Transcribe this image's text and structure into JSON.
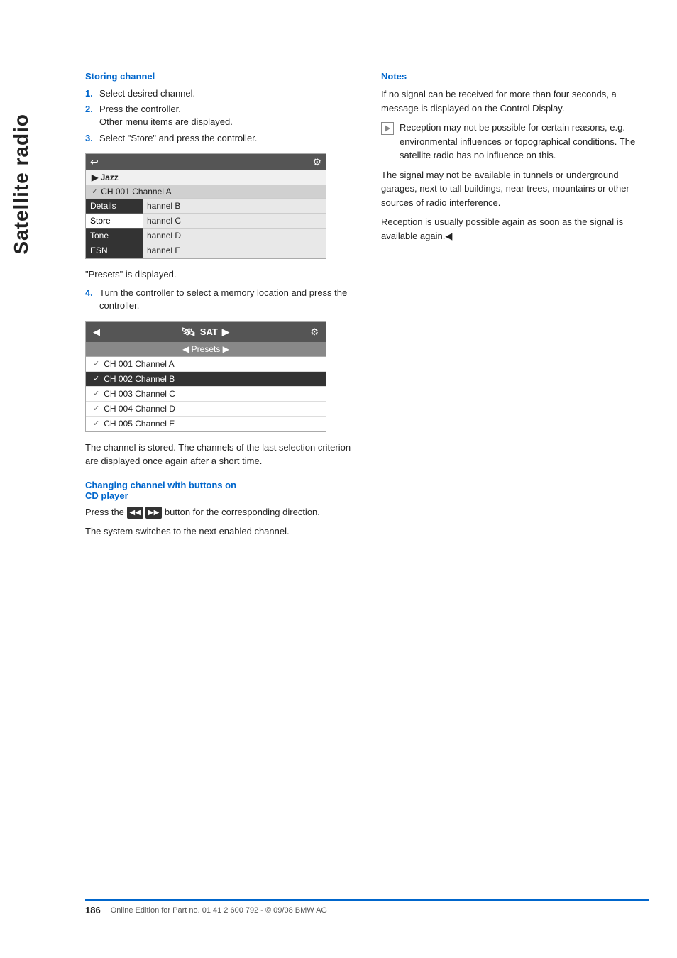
{
  "sidebar": {
    "label": "Satellite radio"
  },
  "left": {
    "section1_title": "Storing channel",
    "steps": [
      {
        "num": "1.",
        "text": "Select desired channel."
      },
      {
        "num": "2.",
        "text": "Press the controller.\nOther menu items are displayed."
      },
      {
        "num": "3.",
        "text": "Select \"Store\" and press the controller."
      }
    ],
    "screen1": {
      "header_left": "↩",
      "header_right": "⚙",
      "label": "▶ Jazz",
      "channel_row": "CH 001 Channel A",
      "menu_items": [
        "Details",
        "Store",
        "Tone",
        "ESN"
      ],
      "channel_items": [
        "hannel B",
        "hannel C",
        "hannel D",
        "hannel E"
      ]
    },
    "presets_text": "\"Presets\" is displayed.",
    "step4": {
      "num": "4.",
      "text": "Turn the controller to select a memory location and press the controller."
    },
    "screen2": {
      "header_left": "◀",
      "header_center": "SAT",
      "header_right": "▶",
      "header_icon": "⚙",
      "presets": "◀ Presets ▶",
      "channels": [
        {
          "label": "CH 001 Channel A",
          "selected": false
        },
        {
          "label": "CH 002 Channel B",
          "selected": true
        },
        {
          "label": "CH 003 Channel C",
          "selected": false
        },
        {
          "label": "CH 004 Channel D",
          "selected": false
        },
        {
          "label": "CH 005 Channel E",
          "selected": false
        }
      ]
    },
    "stored_text": "The channel is stored. The channels of the last selection criterion are displayed once again after a short time.",
    "section2_title": "Changing channel with buttons on CD player",
    "cd_para1": "Press the",
    "cd_btn_left": "◀◀",
    "cd_btn_right": "▶▶",
    "cd_para2": "button for the corresponding direction.",
    "cd_para3": "The system switches to the next enabled channel."
  },
  "right": {
    "notes_title": "Notes",
    "note1": "If no signal can be received for more than four seconds, a message is displayed on the Control Display.",
    "note2": "Reception may not be possible for certain reasons, e.g. environmental influences or topographical conditions. The satellite radio has no influence on this.",
    "note3": "The signal may not be available in tunnels or underground garages, next to tall buildings, near trees, mountains or other sources of radio interference.",
    "note4": "Reception is usually possible again as soon as the signal is available again."
  },
  "footer": {
    "page_number": "186",
    "text": "Online Edition for Part no. 01 41 2 600 792 - © 09/08 BMW AG"
  }
}
